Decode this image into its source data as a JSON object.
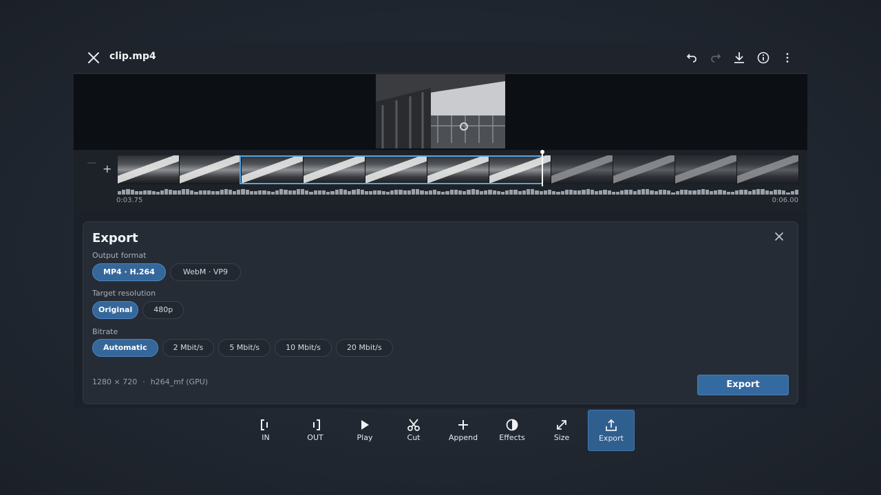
{
  "header": {
    "title": "clip.mp4",
    "icons": [
      "close-icon",
      "undo-icon",
      "redo-icon",
      "download-icon",
      "info-icon",
      "more-vertical-icon"
    ]
  },
  "timeline": {
    "start_time": "0:03.75",
    "end_time": "0:06.00",
    "zoom_out": "−",
    "zoom_in": "+",
    "selection_fraction": [
      0.179,
      0.625
    ],
    "playhead_fraction": 0.625
  },
  "export_panel": {
    "title": "Export",
    "output_format": {
      "label": "Output format",
      "options": [
        "MP4 · H.264",
        "WebM · VP9"
      ],
      "selected": "MP4 · H.264"
    },
    "target_resolution": {
      "label": "Target resolution",
      "options": [
        "Original",
        "480p"
      ],
      "selected": "Original"
    },
    "bitrate": {
      "label": "Bitrate",
      "options": [
        "Automatic",
        "2 Mbit/s",
        "5 Mbit/s",
        "10 Mbit/s",
        "20 Mbit/s"
      ],
      "selected": "Automatic"
    },
    "meta_resolution": "1280 × 720",
    "meta_separator": "·",
    "meta_encoder": "h264_mf (GPU)",
    "export_button": "Export"
  },
  "toolbar": {
    "items": [
      {
        "label": "IN",
        "icon": "mark-in-icon"
      },
      {
        "label": "OUT",
        "icon": "mark-out-icon"
      },
      {
        "label": "Play",
        "icon": "play-icon"
      },
      {
        "label": "Cut",
        "icon": "scissors-icon"
      },
      {
        "label": "Append",
        "icon": "plus-icon"
      },
      {
        "label": "Effects",
        "icon": "contrast-icon"
      },
      {
        "label": "Size",
        "icon": "resize-icon"
      },
      {
        "label": "Export",
        "icon": "upload-icon",
        "active": true
      }
    ]
  },
  "colors": {
    "accent": "#35679a",
    "selection": "#5aa2dc",
    "background": "#1c2129"
  }
}
